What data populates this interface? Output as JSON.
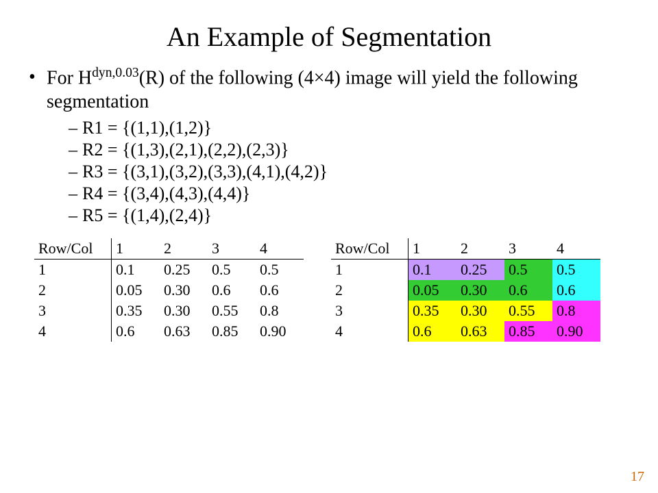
{
  "title": "An Example of Segmentation",
  "intro_html": "For H<sup>dyn,0.03</sup>(R) of the following (4×4) image will yield the following segmentation",
  "regions": [
    "R1 = {(1,1),(1,2)}",
    "R2 = {(1,3),(2,1),(2,2),(2,3)}",
    "R3 = {(3,1),(3,2),(3,3),(4,1),(4,2)}",
    "R4 = {(3,4),(4,3),(4,4)}",
    "R5 = {(1,4),(2,4)}"
  ],
  "table": {
    "row_col_label": "Row/Col",
    "cols": [
      "1",
      "2",
      "3",
      "4"
    ],
    "rows": [
      "1",
      "2",
      "3",
      "4"
    ],
    "data": [
      [
        "0.1",
        "0.25",
        "0.5",
        "0.5"
      ],
      [
        "0.05",
        "0.30",
        "0.6",
        "0.6"
      ],
      [
        "0.35",
        "0.30",
        "0.55",
        "0.8"
      ],
      [
        "0.6",
        "0.63",
        "0.85",
        "0.90"
      ]
    ]
  },
  "segment_colors": {
    "R1": "#c699ff",
    "R2": "#33cc33",
    "R3": "#ffff00",
    "R4": "#ff33ff",
    "R5": "#33ffff"
  },
  "segment_map": [
    [
      "R1",
      "R1",
      "R2",
      "R5"
    ],
    [
      "R2",
      "R2",
      "R2",
      "R5"
    ],
    [
      "R3",
      "R3",
      "R3",
      "R4"
    ],
    [
      "R3",
      "R3",
      "R4",
      "R4"
    ]
  ],
  "page_number": "17"
}
